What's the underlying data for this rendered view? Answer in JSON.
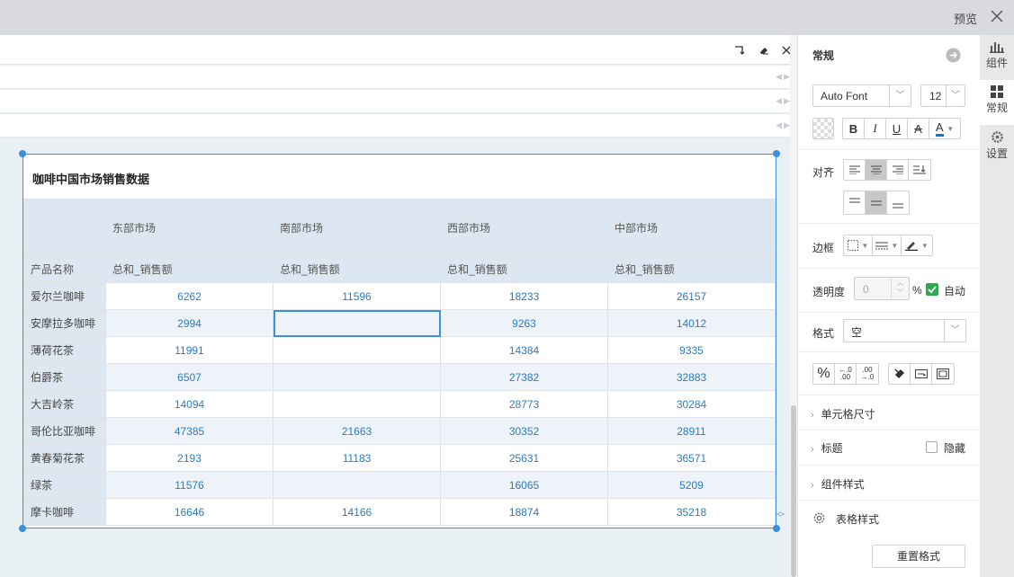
{
  "topbar": {
    "preview_label": "预览",
    "close_icon": "close-icon"
  },
  "widget": {
    "title": "咖啡中国市场销售数据",
    "table": {
      "regions": [
        "东部市场",
        "南部市场",
        "西部市场",
        "中部市场"
      ],
      "row_header": "产品名称",
      "measure": "总和_销售额",
      "rows": [
        {
          "name": "爱尔兰咖啡",
          "values": [
            "6262",
            "11596",
            "18233",
            "26157"
          ]
        },
        {
          "name": "安摩拉多咖啡",
          "values": [
            "2994",
            "",
            "9263",
            "14012"
          ]
        },
        {
          "name": "薄荷花茶",
          "values": [
            "11991",
            "",
            "14384",
            "9335"
          ]
        },
        {
          "name": "伯爵茶",
          "values": [
            "6507",
            "",
            "27382",
            "32883"
          ]
        },
        {
          "name": "大吉岭茶",
          "values": [
            "14094",
            "",
            "28773",
            "30284"
          ]
        },
        {
          "name": "哥伦比亚咖啡",
          "values": [
            "47385",
            "21663",
            "30352",
            "28911"
          ]
        },
        {
          "name": "黄春菊花茶",
          "values": [
            "2193",
            "11183",
            "25631",
            "36571"
          ]
        },
        {
          "name": "绿茶",
          "values": [
            "11576",
            "",
            "16065",
            "5209"
          ]
        },
        {
          "name": "摩卡咖啡",
          "values": [
            "16646",
            "14166",
            "18874",
            "35218"
          ]
        }
      ],
      "selected_cell": {
        "row": 1,
        "col": 1
      }
    }
  },
  "panel": {
    "section_title": "常规",
    "font_family": "Auto Font",
    "font_size": "12",
    "align_label": "对齐",
    "border_label": "边框",
    "opacity_label": "透明度",
    "opacity_value": "0",
    "opacity_unit": "%",
    "opacity_auto_label": "自动",
    "opacity_auto_checked": true,
    "format_label": "格式",
    "format_value": "空",
    "cell_size_label": "单元格尺寸",
    "title_label": "标题",
    "hide_label": "隐藏",
    "widget_style_label": "组件样式",
    "table_style_label": "表格样式",
    "reset_label": "重置格式",
    "font_color": "#1a73d0"
  },
  "tabs": [
    {
      "label": "组件",
      "icon": "bar-chart-icon"
    },
    {
      "label": "常规",
      "icon": "grid-icon",
      "active": true
    },
    {
      "label": "设置",
      "icon": "gear-icon"
    }
  ],
  "colors": {
    "accent": "#3b8fe0",
    "checkbox": "#2fa84f",
    "header_bg": "#dde7f1"
  }
}
